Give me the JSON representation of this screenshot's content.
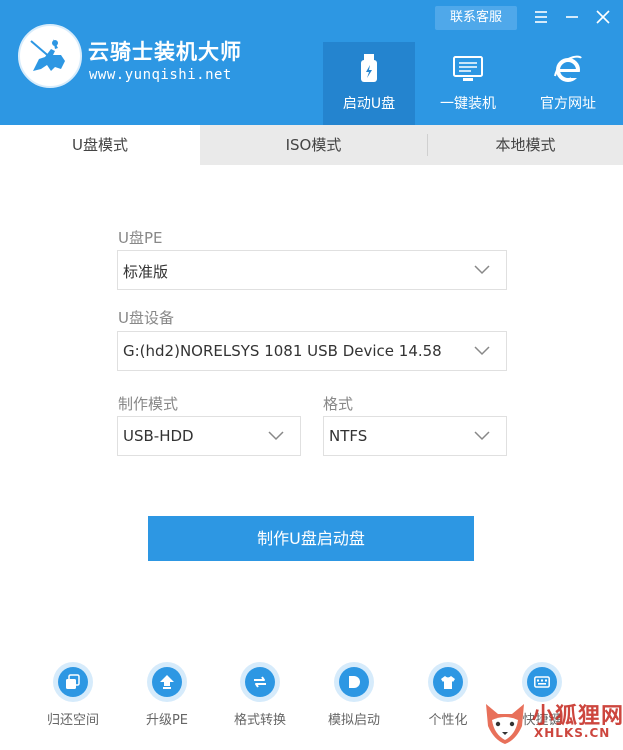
{
  "app": {
    "brand_name": "云骑士装机大师",
    "brand_url": "www.yunqishi.net",
    "support_label": "联系客服"
  },
  "nav": {
    "tabs": [
      {
        "label": "启动U盘",
        "icon": "usb-icon",
        "active": true
      },
      {
        "label": "一键装机",
        "icon": "monitor-icon",
        "active": false
      },
      {
        "label": "官方网址",
        "icon": "browser-ie-icon",
        "active": false
      }
    ]
  },
  "mode_tabs": [
    {
      "label": "U盘模式",
      "active": true
    },
    {
      "label": "ISO模式",
      "active": false
    },
    {
      "label": "本地模式",
      "active": false
    }
  ],
  "form": {
    "pe": {
      "label": "U盘PE",
      "value": "标准版"
    },
    "device": {
      "label": "U盘设备",
      "value": "G:(hd2)NORELSYS 1081 USB Device 14.58"
    },
    "mode": {
      "label": "制作模式",
      "value": "USB-HDD"
    },
    "format": {
      "label": "格式",
      "value": "NTFS"
    }
  },
  "primary_action": "制作U盘启动盘",
  "tools": [
    {
      "label": "归还空间",
      "icon": "restore-space-icon"
    },
    {
      "label": "升级PE",
      "icon": "upgrade-icon"
    },
    {
      "label": "格式转换",
      "icon": "convert-icon"
    },
    {
      "label": "模拟启动",
      "icon": "simulate-start-icon"
    },
    {
      "label": "个性化",
      "icon": "tshirt-icon"
    },
    {
      "label": "快捷键",
      "icon": "keyboard-icon"
    }
  ],
  "watermark": {
    "title": "小狐狸网",
    "site": "XHLKS.CN"
  },
  "colors": {
    "primary": "#2d97e3",
    "active_nav": "#2484cf",
    "tab_bar": "#eaeaea",
    "watermark": "#c8332a"
  }
}
